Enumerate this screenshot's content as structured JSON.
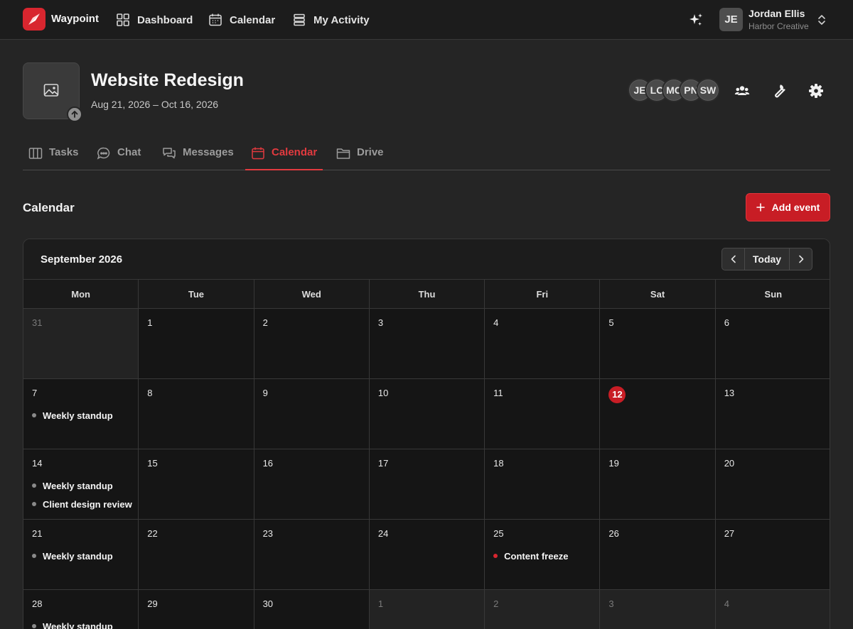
{
  "app": {
    "name": "Waypoint",
    "brand_color": "#d8262f"
  },
  "nav": [
    {
      "label": "Dashboard",
      "icon": "grid-icon"
    },
    {
      "label": "Calendar",
      "icon": "calendar-icon"
    },
    {
      "label": "My Activity",
      "icon": "activity-icon"
    }
  ],
  "user": {
    "initials": "JE",
    "name": "Jordan Ellis",
    "org": "Harbor Creative"
  },
  "project": {
    "title": "Website Redesign",
    "dates": "Aug 21, 2026 – Oct 16, 2026",
    "members": [
      "JE",
      "LC",
      "MC",
      "PN",
      "SW"
    ]
  },
  "tabs": [
    {
      "label": "Tasks",
      "icon": "columns-icon"
    },
    {
      "label": "Chat",
      "icon": "chat-icon"
    },
    {
      "label": "Messages",
      "icon": "messages-icon"
    },
    {
      "label": "Calendar",
      "icon": "calendar-icon",
      "active": true
    },
    {
      "label": "Drive",
      "icon": "folder-icon"
    }
  ],
  "section": {
    "title": "Calendar",
    "add_label": "Add event"
  },
  "calendar": {
    "month": "September 2026",
    "today_label": "Today",
    "weekdays": [
      "Mon",
      "Tue",
      "Wed",
      "Thu",
      "Fri",
      "Sat",
      "Sun"
    ],
    "today_day": 12,
    "weeks": [
      [
        {
          "d": 31,
          "out": true
        },
        {
          "d": 1
        },
        {
          "d": 2
        },
        {
          "d": 3
        },
        {
          "d": 4
        },
        {
          "d": 5
        },
        {
          "d": 6
        }
      ],
      [
        {
          "d": 7,
          "events": [
            {
              "title": "Weekly standup"
            }
          ]
        },
        {
          "d": 8
        },
        {
          "d": 9
        },
        {
          "d": 10
        },
        {
          "d": 11
        },
        {
          "d": 12,
          "today": true
        },
        {
          "d": 13
        }
      ],
      [
        {
          "d": 14,
          "events": [
            {
              "title": "Weekly standup"
            },
            {
              "title": "Client design review"
            }
          ]
        },
        {
          "d": 15
        },
        {
          "d": 16
        },
        {
          "d": 17
        },
        {
          "d": 18
        },
        {
          "d": 19
        },
        {
          "d": 20
        }
      ],
      [
        {
          "d": 21,
          "events": [
            {
              "title": "Weekly standup"
            }
          ]
        },
        {
          "d": 22
        },
        {
          "d": 23
        },
        {
          "d": 24
        },
        {
          "d": 25,
          "events": [
            {
              "title": "Content freeze",
              "highlight": true
            }
          ]
        },
        {
          "d": 26
        },
        {
          "d": 27
        }
      ],
      [
        {
          "d": 28,
          "events": [
            {
              "title": "Weekly standup"
            }
          ]
        },
        {
          "d": 29
        },
        {
          "d": 30
        },
        {
          "d": 1,
          "out": true
        },
        {
          "d": 2,
          "out": true
        },
        {
          "d": 3,
          "out": true
        },
        {
          "d": 4,
          "out": true
        }
      ]
    ]
  }
}
